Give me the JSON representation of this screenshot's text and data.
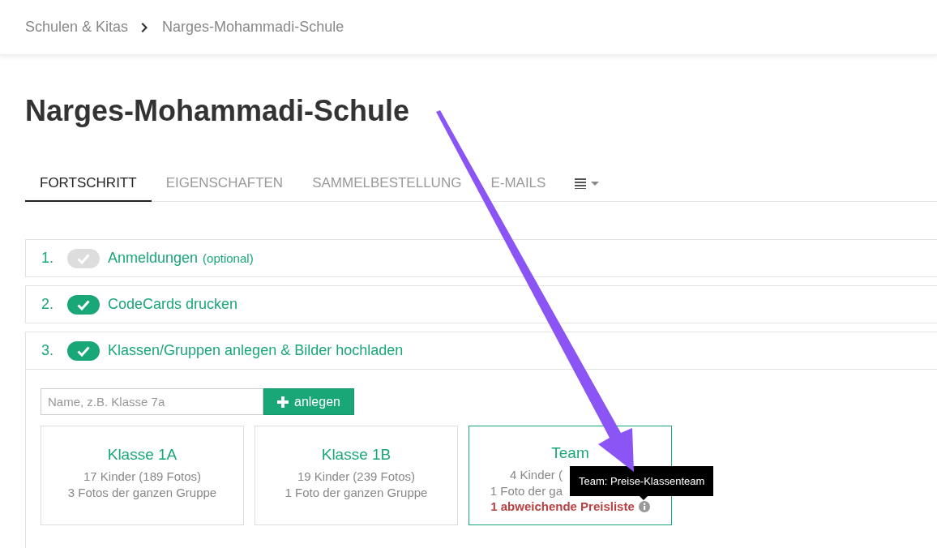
{
  "breadcrumb": {
    "items": [
      "Schulen & Kitas",
      "Narges-Mohammadi-Schule"
    ]
  },
  "title": "Narges-Mohammadi-Schule",
  "tabs": [
    {
      "label": "FORTSCHRITT",
      "selected": true
    },
    {
      "label": "EIGENSCHAFTEN",
      "selected": false
    },
    {
      "label": "SAMMELBESTELLUNG",
      "selected": false
    },
    {
      "label": "E-MAILS",
      "selected": false
    }
  ],
  "steps": [
    {
      "number": "1.",
      "done": false,
      "label": "Anmeldungen",
      "note": "(optional)"
    },
    {
      "number": "2.",
      "done": true,
      "label": "CodeCards drucken"
    },
    {
      "number": "3.",
      "done": true,
      "label": "Klassen/Gruppen anlegen & Bilder hochladen",
      "expanded": true
    }
  ],
  "new_group": {
    "placeholder": "Name, z.B. Klasse 7a",
    "button": "anlegen"
  },
  "groups": [
    {
      "name": "Klasse 1A",
      "selected": false,
      "lines": [
        "17 Kinder (189 Fotos)",
        "3 Fotos der ganzen Gruppe"
      ]
    },
    {
      "name": "Klasse 1B",
      "selected": false,
      "lines": [
        "19 Kinder (239 Fotos)",
        "1 Foto der ganzen Gruppe"
      ]
    },
    {
      "name": "Team",
      "selected": true,
      "lines": [
        "4 Kinder (",
        "1 Foto der ga"
      ],
      "warning": "1 abweichende Preisliste"
    }
  ],
  "tooltip": "Team: Preise-Klassenteam"
}
